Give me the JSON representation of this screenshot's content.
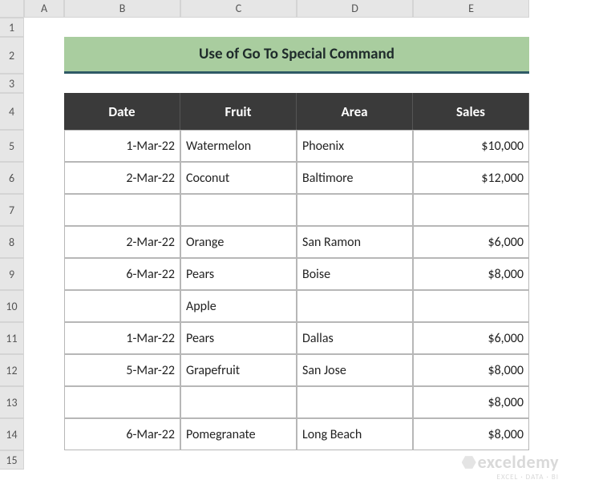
{
  "columns": [
    "A",
    "B",
    "C",
    "D",
    "E"
  ],
  "rows": [
    "1",
    "2",
    "3",
    "4",
    "5",
    "6",
    "7",
    "8",
    "9",
    "10",
    "11",
    "12",
    "13",
    "14",
    "15"
  ],
  "title": "Use of Go To Special Command",
  "headers": {
    "date": "Date",
    "fruit": "Fruit",
    "area": "Area",
    "sales": "Sales"
  },
  "data": [
    {
      "date": "1-Mar-22",
      "fruit": "Watermelon",
      "area": "Phoenix",
      "sales": "$10,000"
    },
    {
      "date": "2-Mar-22",
      "fruit": "Coconut",
      "area": "Baltimore",
      "sales": "$12,000"
    },
    {
      "date": "",
      "fruit": "",
      "area": "",
      "sales": ""
    },
    {
      "date": "2-Mar-22",
      "fruit": "Orange",
      "area": "San Ramon",
      "sales": "$6,000"
    },
    {
      "date": "6-Mar-22",
      "fruit": "Pears",
      "area": "Boise",
      "sales": "$8,000"
    },
    {
      "date": "",
      "fruit": "Apple",
      "area": "",
      "sales": ""
    },
    {
      "date": "1-Mar-22",
      "fruit": "Pears",
      "area": "Dallas",
      "sales": "$6,000"
    },
    {
      "date": "5-Mar-22",
      "fruit": "Grapefruit",
      "area": "San Jose",
      "sales": "$8,000"
    },
    {
      "date": "",
      "fruit": "",
      "area": "",
      "sales": "$8,000"
    },
    {
      "date": "6-Mar-22",
      "fruit": "Pomegranate",
      "area": "Long Beach",
      "sales": "$8,000"
    }
  ],
  "watermark": {
    "main": "exceldemy",
    "sub": "EXCEL · DATA · BI"
  }
}
